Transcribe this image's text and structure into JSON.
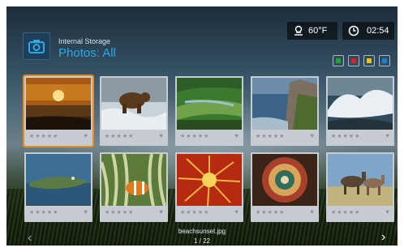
{
  "header": {
    "breadcrumb": "Internal Storage",
    "title": "Photos: All",
    "camera_icon": "camera-icon"
  },
  "status": {
    "temperature": "60°F",
    "time": "02:54",
    "weather_icon": "cloud-icon",
    "clock_icon": "clock-icon"
  },
  "color_buttons": [
    {
      "name": "green-button",
      "color": "#27a33a"
    },
    {
      "name": "red-button",
      "color": "#d82028"
    },
    {
      "name": "yellow-button",
      "color": "#e8c21c"
    },
    {
      "name": "blue-button",
      "color": "#1d7fd1"
    }
  ],
  "grid": {
    "rating_stars": "★★★★★",
    "favorite_icon": "heart-icon",
    "photos": [
      {
        "subject": "beach-sunset",
        "selected": true
      },
      {
        "subject": "bear"
      },
      {
        "subject": "aerial-landscape"
      },
      {
        "subject": "cliff-coast"
      },
      {
        "subject": "crashing-wave"
      },
      {
        "subject": "alligator"
      },
      {
        "subject": "clownfish"
      },
      {
        "subject": "flower"
      },
      {
        "subject": "ornament"
      },
      {
        "subject": "horses"
      }
    ]
  },
  "footer": {
    "filename": "beachsunset.jpg",
    "index": "1 / 22",
    "prev_arrow": "‹",
    "next_arrow": "›"
  }
}
